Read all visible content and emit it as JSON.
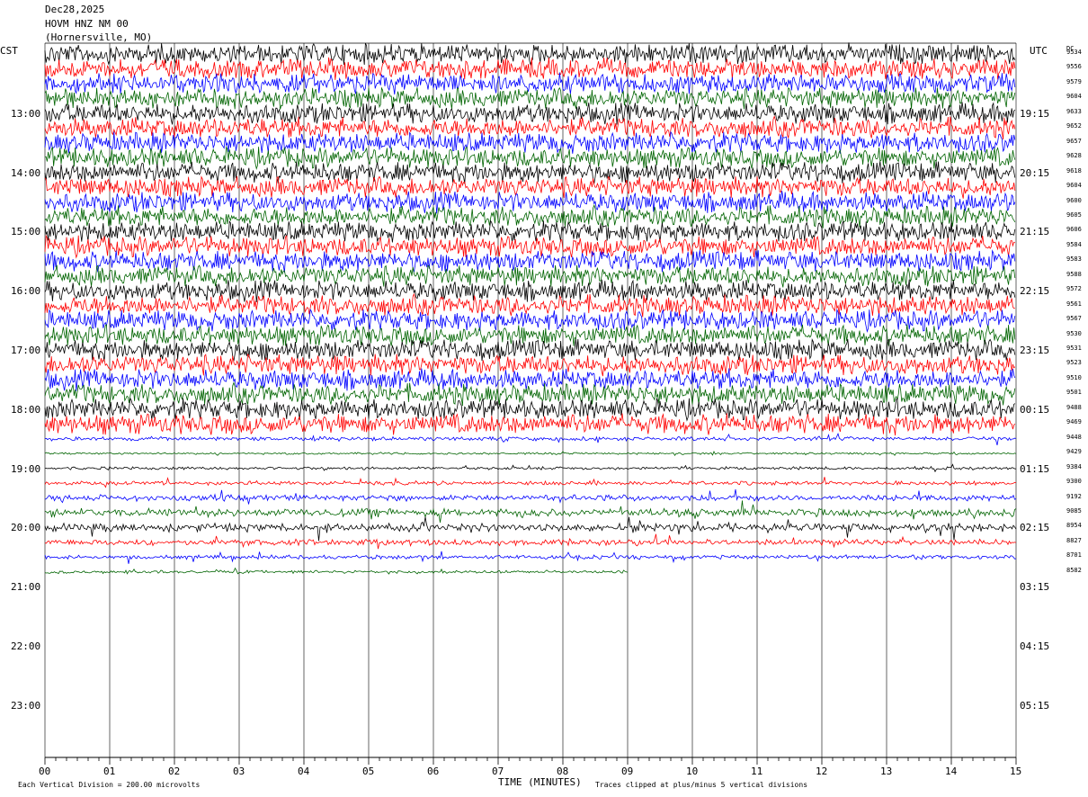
{
  "header": {
    "date": "Dec28,2025",
    "station": "HOVM HNZ NM 00",
    "location": "(Hornersville, MO)"
  },
  "axes": {
    "left_label": "CST",
    "right_label": "UTC",
    "dc_label": "DC",
    "xlabel": "TIME (MINUTES)",
    "left_scale_note": "Each Vertical Division =  200.00 microvolts",
    "right_scale_note": "Traces clipped at plus/minus 5 vertical divisions"
  },
  "chart_data": {
    "type": "line",
    "title": "",
    "x_ticks": [
      "00",
      "01",
      "02",
      "03",
      "04",
      "05",
      "06",
      "07",
      "08",
      "09",
      "10",
      "11",
      "12",
      "13",
      "14",
      "15"
    ],
    "xlim": [
      0,
      15
    ],
    "left_hour_labels": [
      "13:00",
      "14:00",
      "15:00",
      "16:00",
      "17:00",
      "18:00",
      "19:00",
      "20:00",
      "21:00",
      "22:00",
      "23:00"
    ],
    "right_hour_labels": [
      "19:15",
      "20:15",
      "21:15",
      "22:15",
      "23:15",
      "00:15",
      "01:15",
      "02:15",
      "03:15",
      "04:15",
      "05:15"
    ],
    "trace_colors": [
      "#000000",
      "#ff0000",
      "#0000ff",
      "#006400"
    ],
    "traces_per_hour": 4,
    "dc_offsets": [
      9534,
      9556,
      9579,
      9604,
      9633,
      9652,
      9657,
      9628,
      9618,
      9604,
      9600,
      9605,
      9606,
      9584,
      9583,
      9588,
      9572,
      9561,
      9567,
      9530,
      9531,
      9523,
      9510,
      9501,
      9488,
      9469,
      9448,
      9429,
      9384,
      9300,
      9192,
      9085,
      8954,
      8827,
      8701,
      8582
    ],
    "trace_activity": [
      10,
      10,
      10,
      10,
      10,
      10,
      10,
      10,
      10,
      10,
      10,
      10,
      10,
      10,
      10,
      10,
      10,
      10,
      10,
      10,
      10,
      10,
      10,
      10,
      10,
      10,
      2,
      1,
      1.5,
      2,
      3,
      4,
      4,
      3,
      2,
      1.5
    ],
    "last_trace_minutes": 9
  }
}
